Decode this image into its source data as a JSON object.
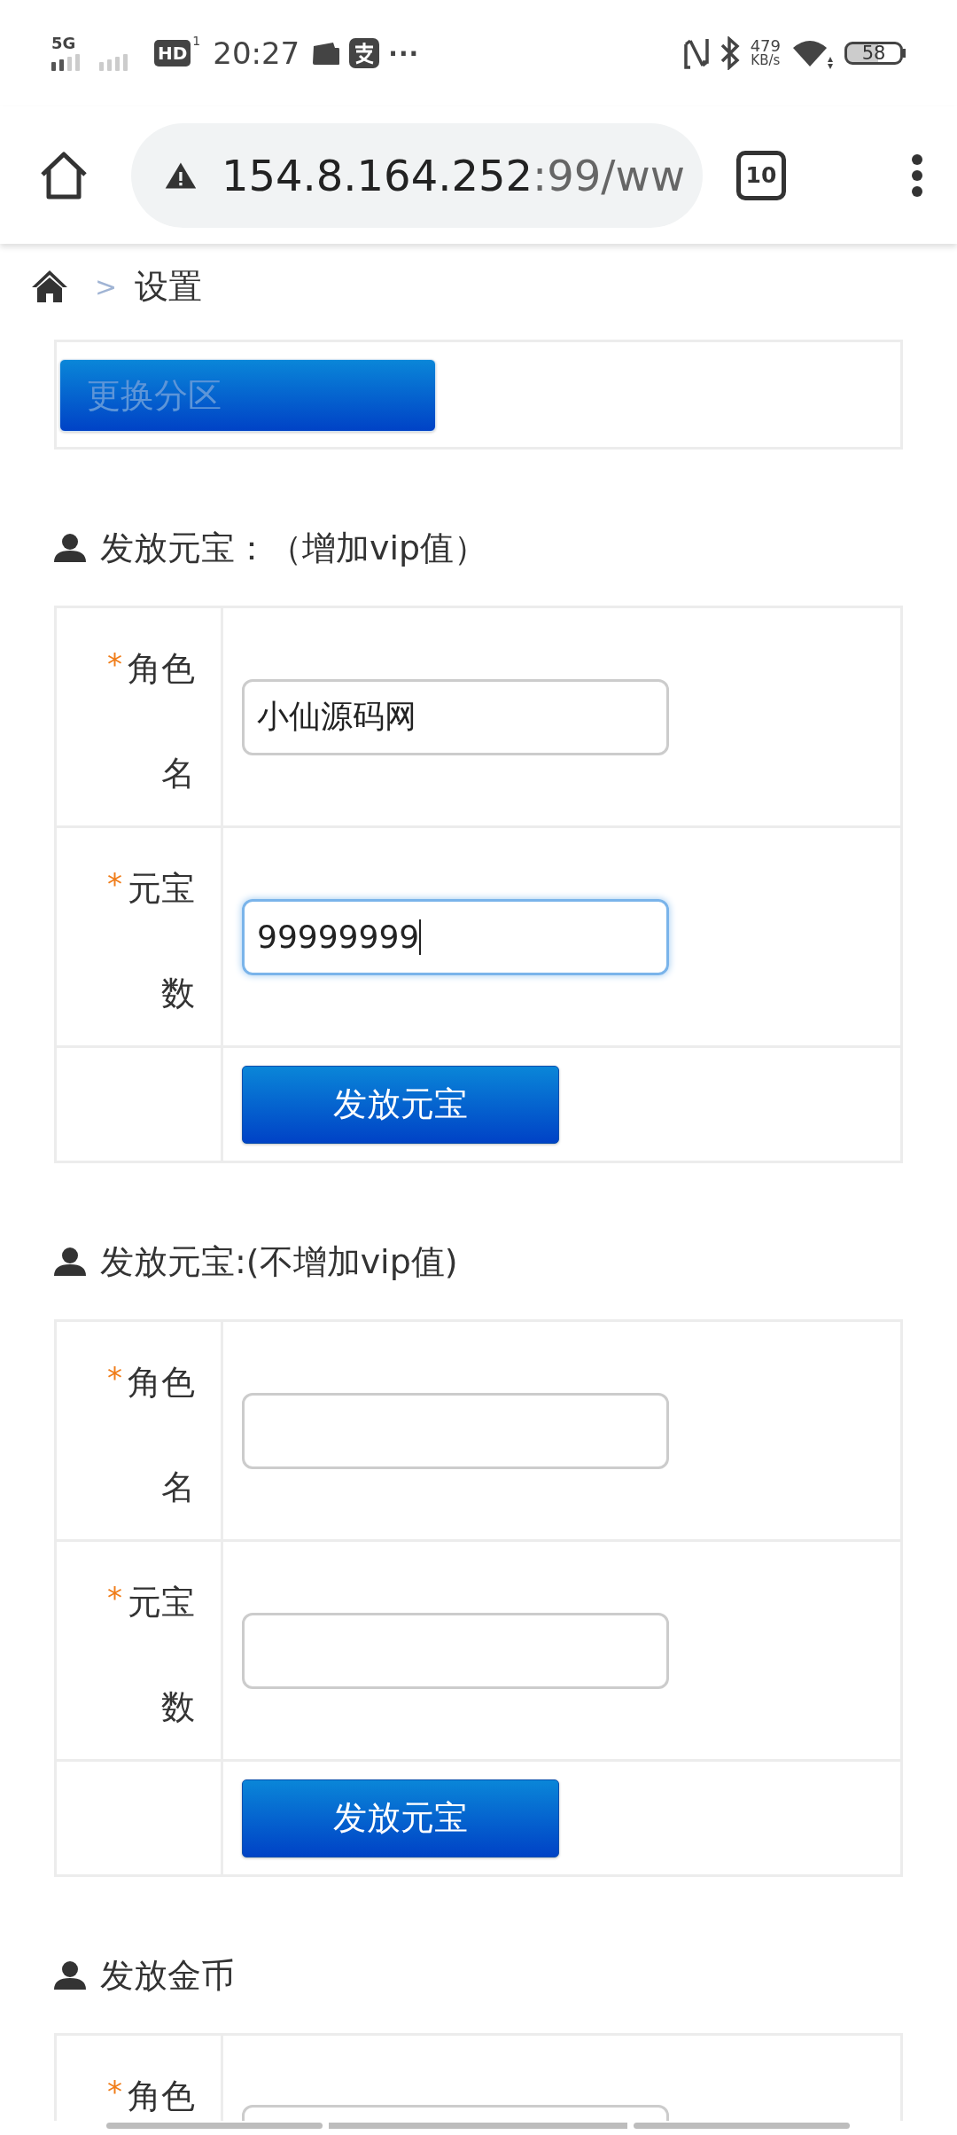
{
  "status_bar": {
    "network": "5G",
    "hd_badge": "HD",
    "sim_index": "1",
    "time": "20:27",
    "more": "···",
    "speed_value": "479",
    "speed_unit": "KB/s",
    "battery": "58"
  },
  "browser": {
    "url_host": "154.8.164.252",
    "url_rest": ":99/ww",
    "tab_count": "10"
  },
  "breadcrumb": {
    "separator": ">",
    "current": "设置"
  },
  "partition_button": {
    "label": "更换分区",
    "disabled": true
  },
  "sections": [
    {
      "title": "发放元宝：（增加vip值）",
      "fields": [
        {
          "required_mark": "*",
          "label": "角色名",
          "value": "小仙源码网",
          "focused": false
        },
        {
          "required_mark": "*",
          "label": "元宝数",
          "value": "99999999",
          "focused": true
        }
      ],
      "button": "发放元宝"
    },
    {
      "title": "发放元宝:(不增加vip值)",
      "fields": [
        {
          "required_mark": "*",
          "label": "角色名",
          "focused": false
        },
        {
          "required_mark": "*",
          "label": "元宝数",
          "focused": false
        }
      ],
      "button": "发放元宝"
    },
    {
      "title": "发放金币",
      "fields": [
        {
          "required_mark": "*",
          "label": "角色",
          "focused": false
        }
      ]
    }
  ]
}
